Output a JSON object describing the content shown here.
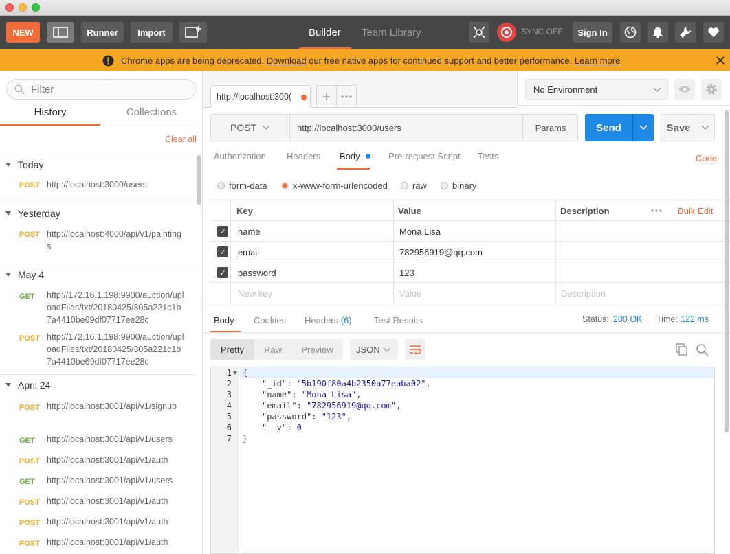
{
  "toolbar": {
    "new_label": "NEW",
    "runner_label": "Runner",
    "import_label": "Import",
    "tab_builder": "Builder",
    "tab_team_library": "Team Library",
    "sync_label": "SYNC OFF",
    "sign_in_label": "Sign In",
    "accent_color": "#f26b3a"
  },
  "banner": {
    "text_before": "Chrome apps are being deprecated.",
    "link_download": "Download",
    "text_after": "our free native apps for continued support and better performance.",
    "link_learn_more": "Learn more",
    "color": "#f5a623"
  },
  "sidebar": {
    "filter_placeholder": "Filter",
    "tab_history": "History",
    "tab_collections": "Collections",
    "clear_all": "Clear all",
    "groups": [
      {
        "title": "Today",
        "items": [
          {
            "method": "POST",
            "url": "http://localhost:3000/users"
          }
        ]
      },
      {
        "title": "Yesterday",
        "items": [
          {
            "method": "POST",
            "url": "http://localhost:4000/api/v1/paintings"
          }
        ]
      },
      {
        "title": "May 4",
        "items": [
          {
            "method": "GET",
            "url": "http://172.16.1.198:9900/auction/uploadFiles/txt/20180425/305a221c1b7a4410be69df07717ee28c"
          },
          {
            "method": "POST",
            "url": "http://172.16.1.198:9900/auction/uploadFiles/txt/20180425/305a221c1b7a4410be69df07717ee28c"
          }
        ]
      },
      {
        "title": "April 24",
        "items": [
          {
            "method": "POST",
            "url": "http://localhost:3001/api/v1/signup"
          },
          {
            "method": "GET",
            "url": "http://localhost:3001/api/v1/users"
          },
          {
            "method": "POST",
            "url": "http://localhost:3001/api/v1/auth"
          },
          {
            "method": "GET",
            "url": "http://localhost:3001/api/v1/users"
          },
          {
            "method": "POST",
            "url": "http://localhost:3001/api/v1/auth"
          },
          {
            "method": "POST",
            "url": "http://localhost:3001/api/v1/auth"
          },
          {
            "method": "POST",
            "url": "http://localhost:3001/api/v1/auth"
          }
        ]
      }
    ]
  },
  "request": {
    "tab_title": "http://localhost:300(",
    "environment": "No Environment",
    "method": "POST",
    "url": "http://localhost:3000/users",
    "params_label": "Params",
    "send_label": "Send",
    "save_label": "Save",
    "subtabs": {
      "authorization": "Authorization",
      "headers": "Headers",
      "body": "Body",
      "prerequest": "Pre-request Script",
      "tests": "Tests",
      "code": "Code"
    },
    "body_types": {
      "form_data": "form-data",
      "urlencoded": "x-www-form-urlencoded",
      "raw": "raw",
      "binary": "binary"
    },
    "table": {
      "col_key": "Key",
      "col_value": "Value",
      "col_description": "Description",
      "bulk_edit": "Bulk Edit",
      "rows": [
        {
          "key": "name",
          "value": "Mona Lisa",
          "checked": true
        },
        {
          "key": "email",
          "value": "782956919@qq.com",
          "checked": true
        },
        {
          "key": "password",
          "value": "123",
          "checked": true
        }
      ],
      "new_key_placeholder": "New key",
      "new_value_placeholder": "Value",
      "new_description_placeholder": "Description"
    }
  },
  "response": {
    "tabs": {
      "body": "Body",
      "cookies": "Cookies",
      "headers": "Headers",
      "headers_count": "(6)",
      "test_results": "Test Results"
    },
    "status_label": "Status:",
    "status_value": "200 OK",
    "time_label": "Time:",
    "time_value": "122 ms",
    "view_pretty": "Pretty",
    "view_raw": "Raw",
    "view_preview": "Preview",
    "format": "JSON",
    "line_numbers": [
      "1",
      "2",
      "3",
      "4",
      "5",
      "6",
      "7"
    ],
    "json": {
      "open": "{",
      "k_id": "\"_id\"",
      "v_id": "\"5b190f80a4b2350a77eaba02\"",
      "k_name": "\"name\"",
      "v_name": "\"Mona Lisa\"",
      "k_email": "\"email\"",
      "v_email": "\"782956919@qq.com\"",
      "k_password": "\"password\"",
      "v_password": "\"123\"",
      "k_v": "\"__v\"",
      "v_v": "0",
      "close": "}"
    }
  }
}
